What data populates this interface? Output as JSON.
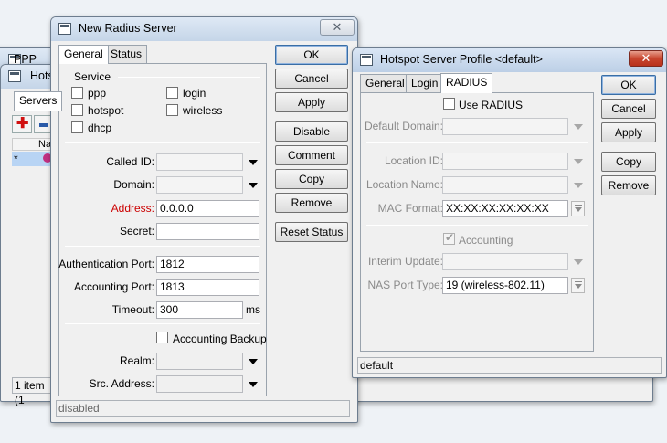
{
  "bg_ppp": {
    "title": "PPP"
  },
  "bg_hotspot": {
    "title": "Hots",
    "tab": "Servers",
    "col_header": "Na",
    "row_marker": "*",
    "status": "1 item (1"
  },
  "radius": {
    "title": "New Radius Server",
    "tabs": [
      "General",
      "Status"
    ],
    "service_label": "Service",
    "services": [
      {
        "label": "ppp",
        "checked": false
      },
      {
        "label": "login",
        "checked": false
      },
      {
        "label": "hotspot",
        "checked": false
      },
      {
        "label": "wireless",
        "checked": false
      },
      {
        "label": "dhcp",
        "checked": false
      }
    ],
    "called_id_label": "Called ID:",
    "domain_label": "Domain:",
    "address_label": "Address:",
    "address_value": "0.0.0.0",
    "secret_label": "Secret:",
    "secret_value": "",
    "auth_port_label": "Authentication Port:",
    "auth_port_value": "1812",
    "acct_port_label": "Accounting Port:",
    "acct_port_value": "1813",
    "timeout_label": "Timeout:",
    "timeout_value": "300",
    "timeout_unit": "ms",
    "acct_backup_label": "Accounting Backup",
    "realm_label": "Realm:",
    "src_address_label": "Src. Address:",
    "status_text": "disabled",
    "buttons": [
      "OK",
      "Cancel",
      "Apply",
      "Disable",
      "Comment",
      "Copy",
      "Remove",
      "Reset Status"
    ]
  },
  "profile": {
    "title": "Hotspot Server Profile <default>",
    "tabs": [
      "General",
      "Login",
      "RADIUS"
    ],
    "use_radius_label": "Use RADIUS",
    "default_domain_label": "Default Domain:",
    "location_id_label": "Location ID:",
    "location_name_label": "Location Name:",
    "mac_format_label": "MAC Format:",
    "mac_format_value": "XX:XX:XX:XX:XX:XX",
    "accounting_label": "Accounting",
    "interim_update_label": "Interim Update:",
    "nas_port_type_label": "NAS Port Type:",
    "nas_port_type_value": "19 (wireless-802.11)",
    "status_text": "default",
    "buttons": [
      "OK",
      "Cancel",
      "Apply",
      "Copy",
      "Remove"
    ]
  },
  "colors": {
    "address_label": "#cc0000",
    "close_active": "#c8452e"
  }
}
